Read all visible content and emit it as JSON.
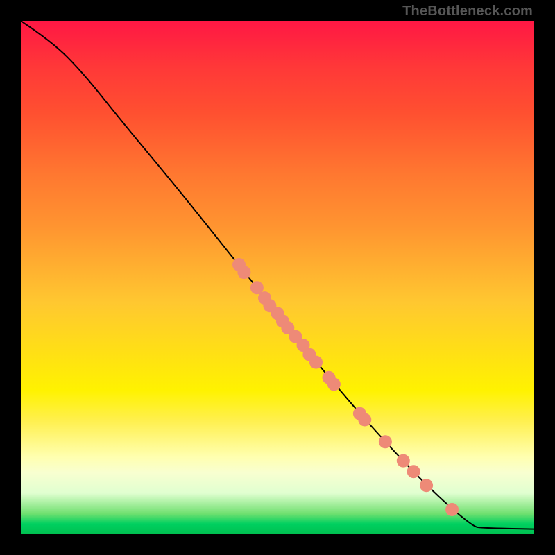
{
  "watermark": "TheBottleneck.com",
  "chart_data": {
    "type": "line",
    "title": "",
    "xlabel": "",
    "ylabel": "",
    "xlim": [
      0,
      100
    ],
    "ylim": [
      0,
      100
    ],
    "curve_points": [
      {
        "x": 0,
        "y": 100
      },
      {
        "x": 6,
        "y": 96
      },
      {
        "x": 12,
        "y": 90
      },
      {
        "x": 20,
        "y": 80
      },
      {
        "x": 30,
        "y": 68
      },
      {
        "x": 40,
        "y": 55.5
      },
      {
        "x": 50,
        "y": 43
      },
      {
        "x": 60,
        "y": 30.5
      },
      {
        "x": 70,
        "y": 19
      },
      {
        "x": 80,
        "y": 8.5
      },
      {
        "x": 88,
        "y": 1.5
      },
      {
        "x": 90,
        "y": 1.2
      },
      {
        "x": 100,
        "y": 1.0
      }
    ],
    "scatter_points": [
      {
        "x": 42.5,
        "y": 52.5
      },
      {
        "x": 43.5,
        "y": 51
      },
      {
        "x": 46,
        "y": 48
      },
      {
        "x": 47.5,
        "y": 46
      },
      {
        "x": 48.5,
        "y": 44.5
      },
      {
        "x": 50,
        "y": 43
      },
      {
        "x": 51,
        "y": 41.5
      },
      {
        "x": 52,
        "y": 40.2
      },
      {
        "x": 53.5,
        "y": 38.5
      },
      {
        "x": 55,
        "y": 36.8
      },
      {
        "x": 56.2,
        "y": 35
      },
      {
        "x": 57.5,
        "y": 33.5
      },
      {
        "x": 60,
        "y": 30.5
      },
      {
        "x": 61,
        "y": 29.2
      },
      {
        "x": 66,
        "y": 23.5
      },
      {
        "x": 67,
        "y": 22.3
      },
      {
        "x": 71,
        "y": 18
      },
      {
        "x": 74.5,
        "y": 14.3
      },
      {
        "x": 76.5,
        "y": 12.2
      },
      {
        "x": 79,
        "y": 9.5
      },
      {
        "x": 84,
        "y": 4.8
      }
    ],
    "point_color": "#ee8a77",
    "line_color": "#000000"
  }
}
